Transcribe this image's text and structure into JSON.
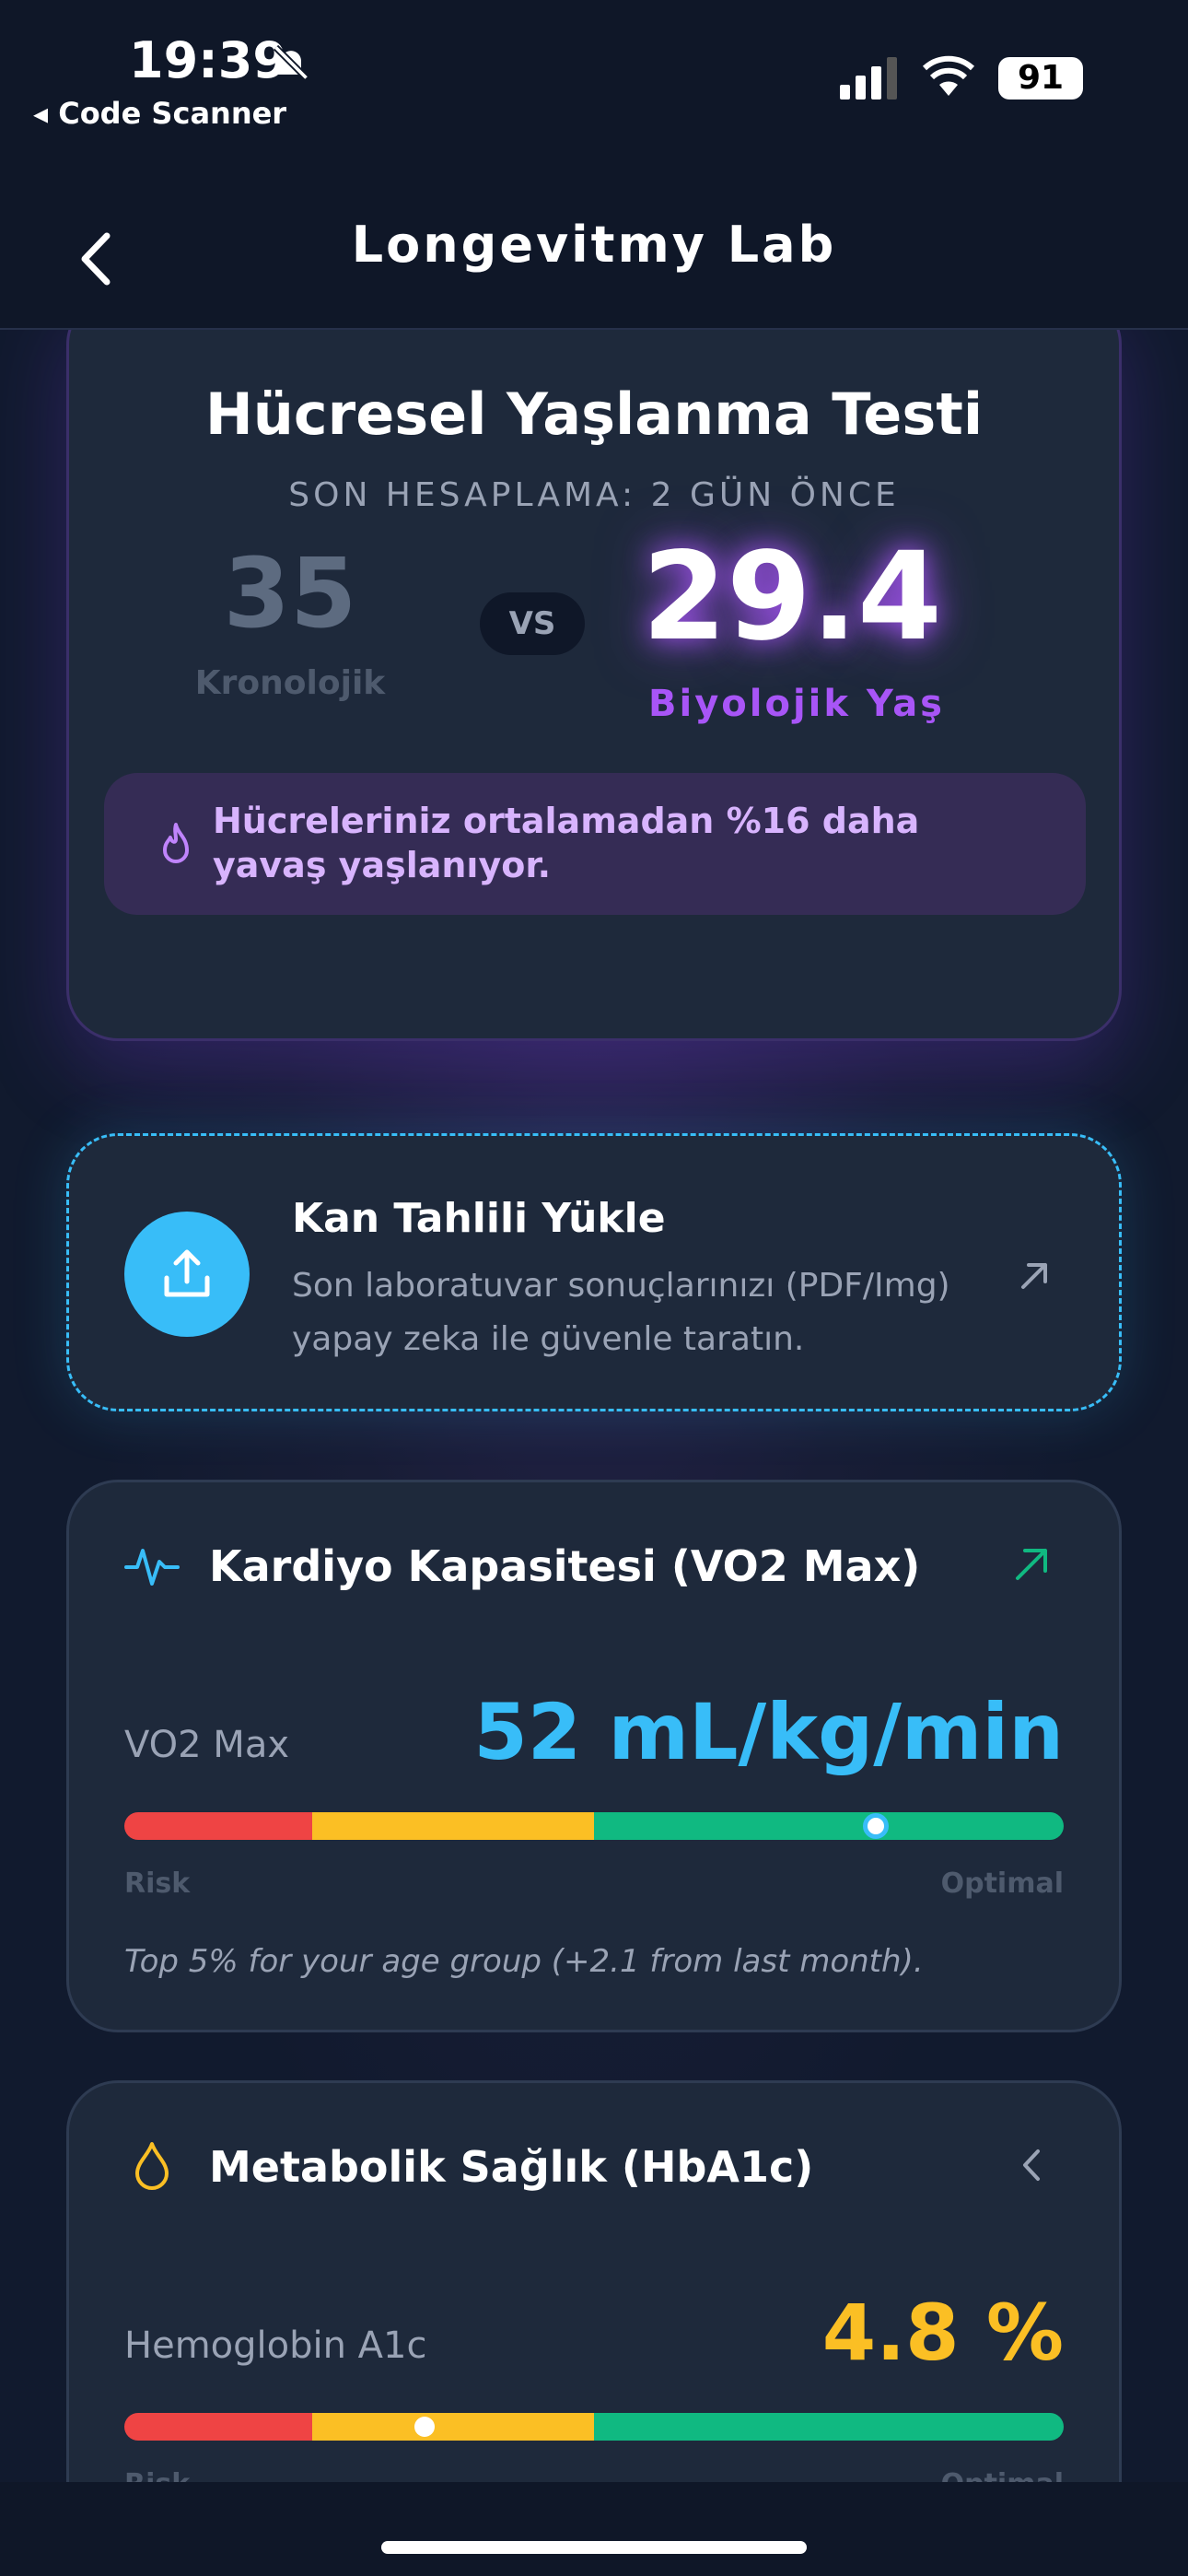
{
  "status_bar": {
    "time": "19:39",
    "back_app": "◂ Code Scanner",
    "battery": "91"
  },
  "nav": {
    "title": "Longevitmy Lab"
  },
  "hero": {
    "title": "Hücresel Yaşlanma Testi",
    "subtitle": "SON HESAPLAMA: 2 GÜN ÖNCE",
    "chronological_age": "35",
    "chronological_label": "Kronolojik",
    "vs": "VS",
    "biological_age": "29.4",
    "biological_label": "Biyolojik Yaş",
    "insight": "Hücreleriniz ortalamadan %16 daha yavaş yaşlanıyor."
  },
  "upload": {
    "title": "Kan Tahlili Yükle",
    "description": "Son laboratuvar sonuçlarınızı (PDF/Img) yapay zeka ile güvenle taratın."
  },
  "metrics": [
    {
      "title": "Kardiyo Kapasitesi (VO2 Max)",
      "label": "VO2 Max",
      "value": "52 mL/kg/min",
      "value_color": "#38bdf8",
      "level_percent": 80,
      "scale_low": "Risk",
      "scale_high": "Optimal",
      "note": "Top 5% for your age group (+2.1 from last month)."
    },
    {
      "title": "Metabolik Sağlık (HbA1c)",
      "label": "Hemoglobin A1c",
      "value": "4.8 %",
      "value_color": "#fbbf24",
      "level_percent": 32,
      "scale_low": "Risk",
      "scale_high": "Optimal"
    }
  ],
  "colors": {
    "accent_purple": "#a855f7",
    "accent_blue": "#38bdf8",
    "accent_yellow": "#fbbf24",
    "accent_green": "#10b981",
    "accent_red": "#ef4444"
  }
}
